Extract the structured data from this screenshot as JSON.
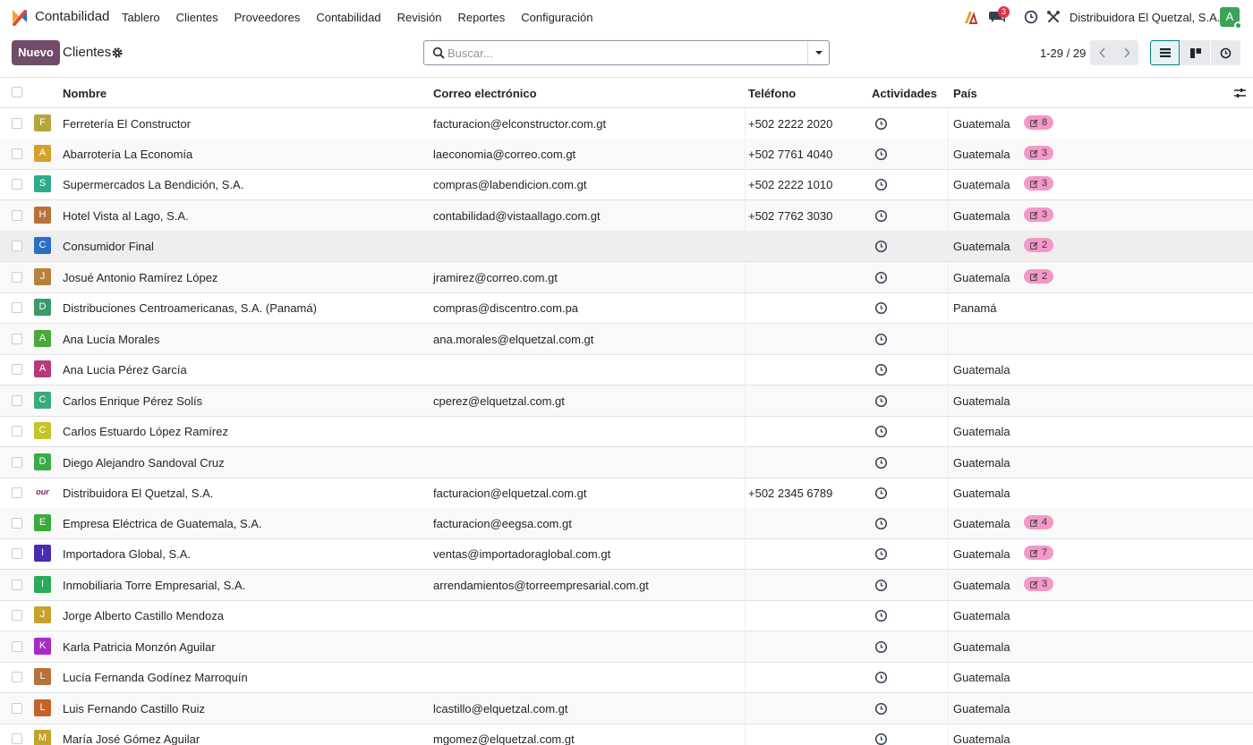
{
  "navbar": {
    "app_name": "Contabilidad",
    "menu": [
      "Tablero",
      "Clientes",
      "Proveedores",
      "Contabilidad",
      "Revisión",
      "Reportes",
      "Configuración"
    ],
    "messages_count": "3",
    "company": "Distribuidora El Quetzal, S.A.",
    "user_initial": "A"
  },
  "control_panel": {
    "new_label": "Nuevo",
    "breadcrumb": "Clientes",
    "search_placeholder": "Buscar...",
    "pager": "1-29 / 29"
  },
  "table": {
    "columns": [
      "Nombre",
      "Correo electrónico",
      "Teléfono",
      "Actividades",
      "País"
    ],
    "rows": [
      {
        "initial": "F",
        "color": "#b5a53a",
        "name": "Ferretería El Constructor",
        "email": "facturacion@elconstructor.com.gt",
        "phone": "+502 2222 2020",
        "country": "Guatemala",
        "tag": "8"
      },
      {
        "initial": "A",
        "color": "#d4a22b",
        "name": "Abarrotería La Economía",
        "email": "laeconomia@correo.com.gt",
        "phone": "+502 7761 4040",
        "country": "Guatemala",
        "tag": "3"
      },
      {
        "initial": "S",
        "color": "#2eab8a",
        "name": "Supermercados La Bendición, S.A.",
        "email": "compras@labendicion.com.gt",
        "phone": "+502 2222 1010",
        "country": "Guatemala",
        "tag": "3"
      },
      {
        "initial": "H",
        "color": "#b5723a",
        "name": "Hotel Vista al Lago, S.A.",
        "email": "contabilidad@vistaallago.com.gt",
        "phone": "+502 7762 3030",
        "country": "Guatemala",
        "tag": "3"
      },
      {
        "initial": "C",
        "color": "#2b6fc4",
        "name": "Consumidor Final",
        "email": "",
        "phone": "",
        "country": "Guatemala",
        "tag": "2"
      },
      {
        "initial": "J",
        "color": "#b5823a",
        "name": "Josué Antonio Ramírez López",
        "email": "jramirez@correo.com.gt",
        "phone": "",
        "country": "Guatemala",
        "tag": "2"
      },
      {
        "initial": "D",
        "color": "#3a9a6a",
        "name": "Distribuciones Centroamericanas, S.A. (Panamá)",
        "email": "compras@discentro.com.pa",
        "phone": "",
        "country": "Panamá",
        "tag": ""
      },
      {
        "initial": "A",
        "color": "#4aa83a",
        "name": "Ana Lucía Morales",
        "email": "ana.morales@elquetzal.com.gt",
        "phone": "",
        "country": "",
        "tag": ""
      },
      {
        "initial": "A",
        "color": "#b53a7a",
        "name": "Ana Lucía Pérez García",
        "email": "",
        "phone": "",
        "country": "Guatemala",
        "tag": ""
      },
      {
        "initial": "C",
        "color": "#3aab7a",
        "name": "Carlos Enrique Pérez Solís",
        "email": "cperez@elquetzal.com.gt",
        "phone": "",
        "country": "Guatemala",
        "tag": ""
      },
      {
        "initial": "C",
        "color": "#c4c42b",
        "name": "Carlos Estuardo López Ramírez",
        "email": "",
        "phone": "",
        "country": "Guatemala",
        "tag": ""
      },
      {
        "initial": "D",
        "color": "#3aab4a",
        "name": "Diego Alejandro Sandoval Cruz",
        "email": "",
        "phone": "",
        "country": "Guatemala",
        "tag": ""
      },
      {
        "initial": "our l",
        "color": "logo",
        "name": "Distribuidora El Quetzal, S.A.",
        "email": "facturacion@elquetzal.com.gt",
        "phone": "+502 2345 6789",
        "country": "Guatemala",
        "tag": ""
      },
      {
        "initial": "E",
        "color": "#3aab3a",
        "name": "Empresa Eléctrica de Guatemala, S.A.",
        "email": "facturacion@eegsa.com.gt",
        "phone": "",
        "country": "Guatemala",
        "tag": "4"
      },
      {
        "initial": "I",
        "color": "#4a2bb5",
        "name": "Importadora Global, S.A.",
        "email": "ventas@importadoraglobal.com.gt",
        "phone": "",
        "country": "Guatemala",
        "tag": "7"
      },
      {
        "initial": "I",
        "color": "#2bab5a",
        "name": "Inmobiliaria Torre Empresarial, S.A.",
        "email": "arrendamientos@torreempresarial.com.gt",
        "phone": "",
        "country": "Guatemala",
        "tag": "3"
      },
      {
        "initial": "J",
        "color": "#c4a22b",
        "name": "Jorge Alberto Castillo Mendoza",
        "email": "",
        "phone": "",
        "country": "Guatemala",
        "tag": ""
      },
      {
        "initial": "K",
        "color": "#a82bc4",
        "name": "Karla Patricia Monzón Aguilar",
        "email": "",
        "phone": "",
        "country": "Guatemala",
        "tag": ""
      },
      {
        "initial": "L",
        "color": "#b5723a",
        "name": "Lucía Fernanda Godínez Marroquín",
        "email": "",
        "phone": "",
        "country": "Guatemala",
        "tag": ""
      },
      {
        "initial": "L",
        "color": "#c4622b",
        "name": "Luis Fernando Castillo Ruiz",
        "email": "lcastillo@elquetzal.com.gt",
        "phone": "",
        "country": "Guatemala",
        "tag": ""
      },
      {
        "initial": "M",
        "color": "#c4a22b",
        "name": "María José Gómez Aguilar",
        "email": "mgomez@elquetzal.com.gt",
        "phone": "",
        "country": "Guatemala",
        "tag": ""
      }
    ]
  }
}
